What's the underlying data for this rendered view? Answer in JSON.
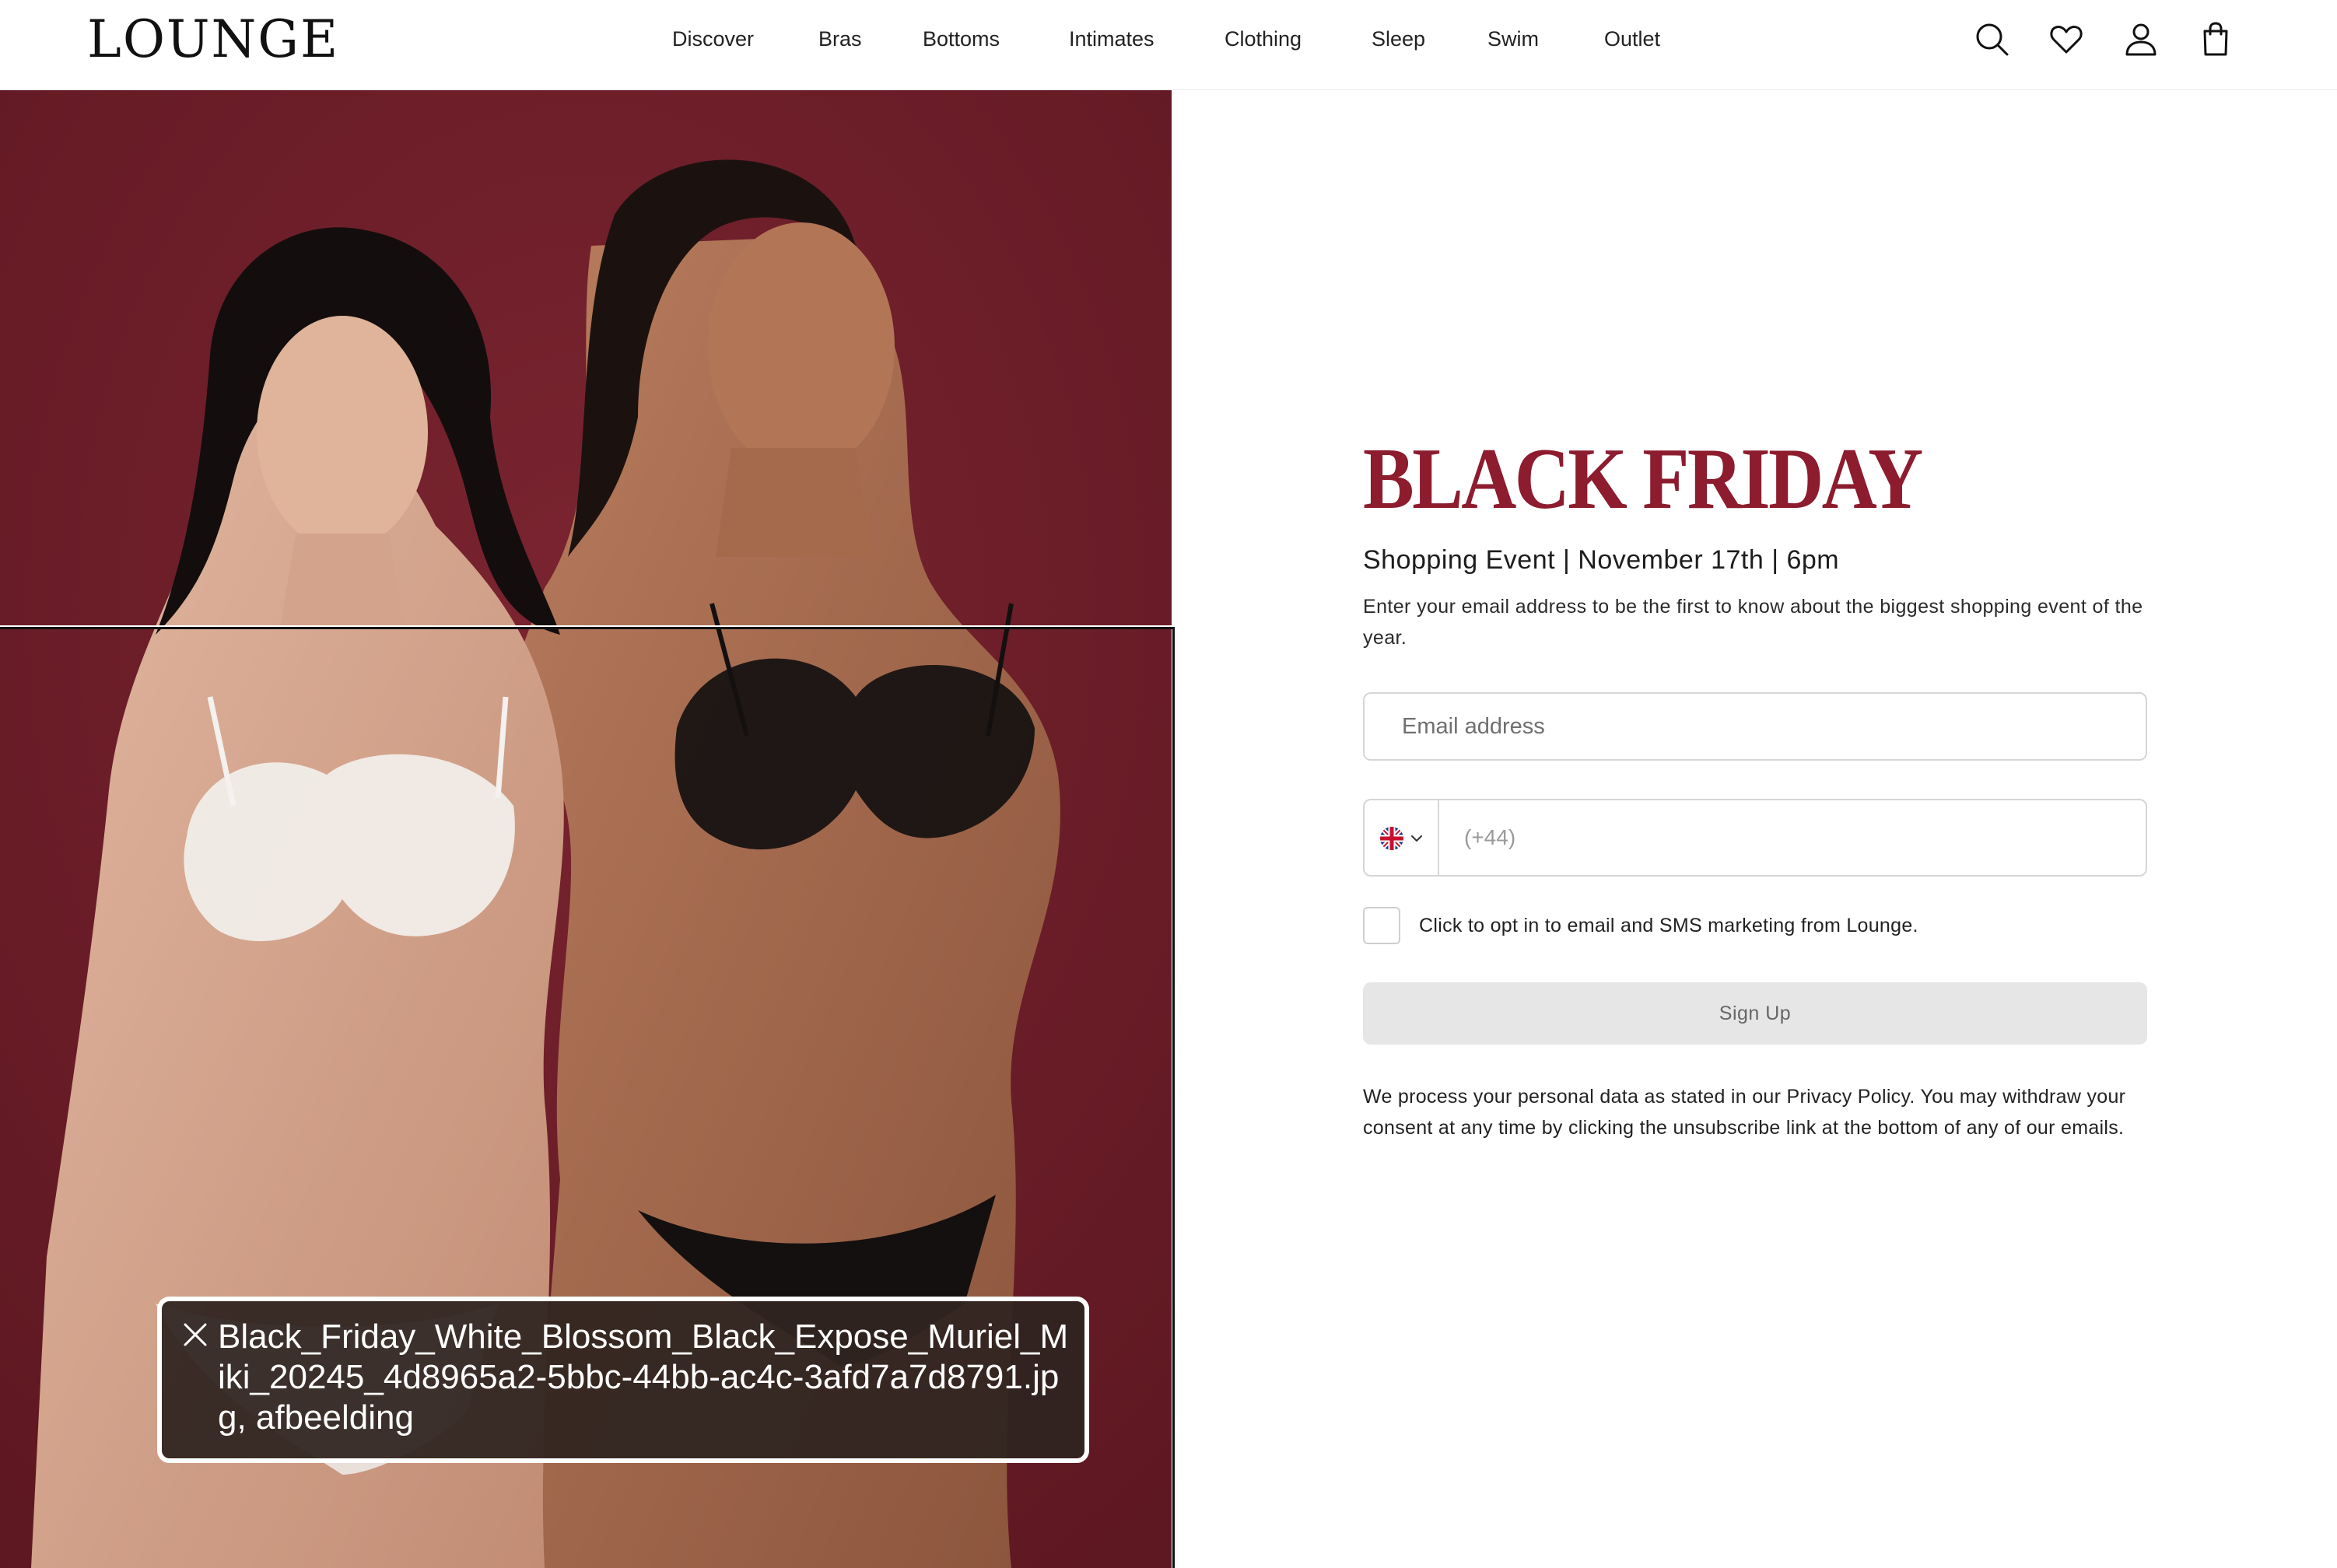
{
  "header": {
    "logo": "LOUNGE",
    "nav": [
      {
        "label": "Discover"
      },
      {
        "label": "Bras"
      },
      {
        "label": "Bottoms"
      },
      {
        "label": "Intimates"
      },
      {
        "label": "Clothing"
      },
      {
        "label": "Sleep"
      },
      {
        "label": "Swim"
      },
      {
        "label": "Outlet"
      }
    ],
    "icons": [
      "search-icon",
      "heart-icon",
      "account-icon",
      "bag-icon"
    ]
  },
  "hero": {
    "background_color": "#6e1e27"
  },
  "caption": {
    "text": "Black_Friday_White_Blossom_Black_Expose_Muriel_Miki_20245_4d8965a2-5bbc-44bb-ac4c-3afd7a7d8791.jpg, afbeelding",
    "close_icon": "close-icon"
  },
  "signup": {
    "title": "BLACK FRIDAY",
    "subtitle": "Shopping Event | November 17th | 6pm",
    "description": "Enter your email address to be the first to know about the biggest shopping event of the year.",
    "email_placeholder": "Email address",
    "phone_placeholder": "(+44)",
    "country_flag": "uk-flag-icon",
    "optin_label": "Click to opt in to email and SMS marketing from Lounge.",
    "optin_checked": false,
    "button_label": "Sign Up",
    "privacy_text": "We process your personal data as stated in our Privacy Policy. You may withdraw your consent at any time by clicking the unsubscribe link at the bottom of any of our emails.",
    "title_color": "#8c1c2e"
  }
}
